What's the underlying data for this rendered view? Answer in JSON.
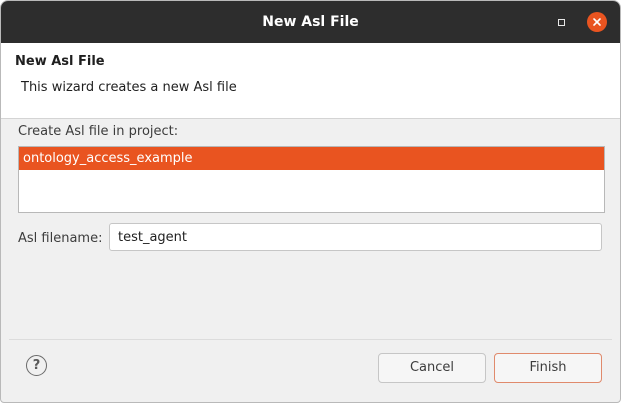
{
  "window": {
    "title": "New Asl File"
  },
  "banner": {
    "title": "New Asl File",
    "description": "This wizard creates a new Asl file"
  },
  "project": {
    "label": "Create Asl file in project:",
    "items": [
      "ontology_access_example"
    ],
    "selected": "ontology_access_example"
  },
  "filename": {
    "label": "Asl filename:",
    "value": "test_agent"
  },
  "footer": {
    "help_symbol": "?",
    "cancel_label": "Cancel",
    "finish_label": "Finish"
  },
  "colors": {
    "accent": "#e95420",
    "titlebar": "#2d2d2d"
  }
}
